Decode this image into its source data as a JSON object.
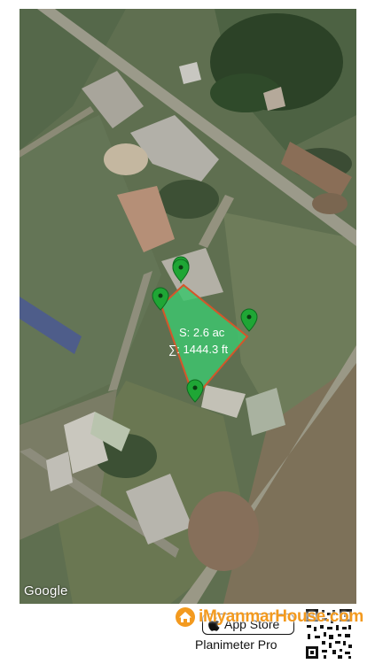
{
  "map": {
    "provider_logo": "Google",
    "measurement": {
      "area_label": "S: 2.6 ac",
      "perimeter_label": "∑: 1444.3 ft",
      "polygon_fill": "#3ec46d",
      "polygon_stroke": "#d4562a",
      "pin_color": "#1fa635"
    },
    "pin_count": 4
  },
  "footer": {
    "appstore_label": "App Store",
    "app_name": "Planimeter Pro",
    "qr_icon": "qr-code-icon",
    "apple_icon": "apple-icon"
  },
  "watermark": {
    "text": "iMyanmarHouse.com",
    "color": "#f39a1f",
    "icon": "house-icon"
  }
}
